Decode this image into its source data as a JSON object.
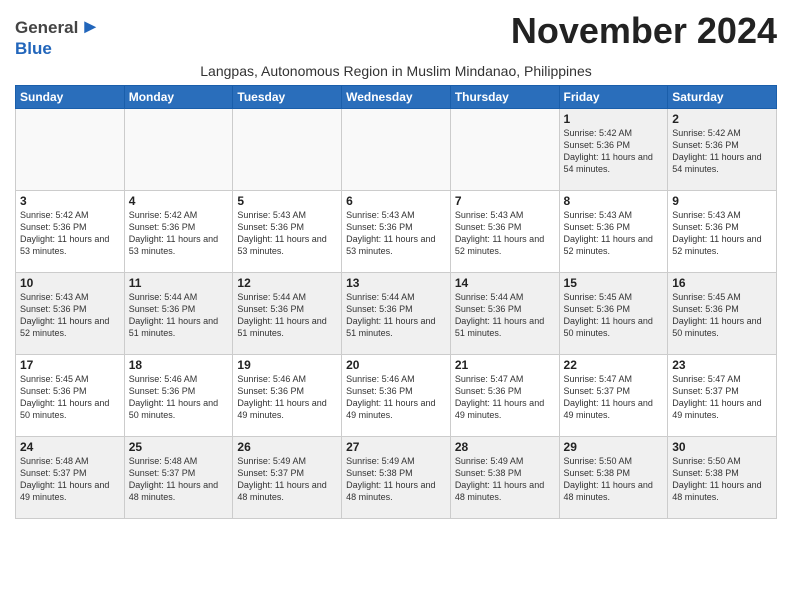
{
  "logo": {
    "general": "General",
    "blue": "Blue"
  },
  "month_title": "November 2024",
  "subtitle": "Langpas, Autonomous Region in Muslim Mindanao, Philippines",
  "weekdays": [
    "Sunday",
    "Monday",
    "Tuesday",
    "Wednesday",
    "Thursday",
    "Friday",
    "Saturday"
  ],
  "weeks": [
    [
      {
        "day": "",
        "info": ""
      },
      {
        "day": "",
        "info": ""
      },
      {
        "day": "",
        "info": ""
      },
      {
        "day": "",
        "info": ""
      },
      {
        "day": "",
        "info": ""
      },
      {
        "day": "1",
        "info": "Sunrise: 5:42 AM\nSunset: 5:36 PM\nDaylight: 11 hours\nand 54 minutes."
      },
      {
        "day": "2",
        "info": "Sunrise: 5:42 AM\nSunset: 5:36 PM\nDaylight: 11 hours\nand 54 minutes."
      }
    ],
    [
      {
        "day": "3",
        "info": "Sunrise: 5:42 AM\nSunset: 5:36 PM\nDaylight: 11 hours\nand 53 minutes."
      },
      {
        "day": "4",
        "info": "Sunrise: 5:42 AM\nSunset: 5:36 PM\nDaylight: 11 hours\nand 53 minutes."
      },
      {
        "day": "5",
        "info": "Sunrise: 5:43 AM\nSunset: 5:36 PM\nDaylight: 11 hours\nand 53 minutes."
      },
      {
        "day": "6",
        "info": "Sunrise: 5:43 AM\nSunset: 5:36 PM\nDaylight: 11 hours\nand 53 minutes."
      },
      {
        "day": "7",
        "info": "Sunrise: 5:43 AM\nSunset: 5:36 PM\nDaylight: 11 hours\nand 52 minutes."
      },
      {
        "day": "8",
        "info": "Sunrise: 5:43 AM\nSunset: 5:36 PM\nDaylight: 11 hours\nand 52 minutes."
      },
      {
        "day": "9",
        "info": "Sunrise: 5:43 AM\nSunset: 5:36 PM\nDaylight: 11 hours\nand 52 minutes."
      }
    ],
    [
      {
        "day": "10",
        "info": "Sunrise: 5:43 AM\nSunset: 5:36 PM\nDaylight: 11 hours\nand 52 minutes."
      },
      {
        "day": "11",
        "info": "Sunrise: 5:44 AM\nSunset: 5:36 PM\nDaylight: 11 hours\nand 51 minutes."
      },
      {
        "day": "12",
        "info": "Sunrise: 5:44 AM\nSunset: 5:36 PM\nDaylight: 11 hours\nand 51 minutes."
      },
      {
        "day": "13",
        "info": "Sunrise: 5:44 AM\nSunset: 5:36 PM\nDaylight: 11 hours\nand 51 minutes."
      },
      {
        "day": "14",
        "info": "Sunrise: 5:44 AM\nSunset: 5:36 PM\nDaylight: 11 hours\nand 51 minutes."
      },
      {
        "day": "15",
        "info": "Sunrise: 5:45 AM\nSunset: 5:36 PM\nDaylight: 11 hours\nand 50 minutes."
      },
      {
        "day": "16",
        "info": "Sunrise: 5:45 AM\nSunset: 5:36 PM\nDaylight: 11 hours\nand 50 minutes."
      }
    ],
    [
      {
        "day": "17",
        "info": "Sunrise: 5:45 AM\nSunset: 5:36 PM\nDaylight: 11 hours\nand 50 minutes."
      },
      {
        "day": "18",
        "info": "Sunrise: 5:46 AM\nSunset: 5:36 PM\nDaylight: 11 hours\nand 50 minutes."
      },
      {
        "day": "19",
        "info": "Sunrise: 5:46 AM\nSunset: 5:36 PM\nDaylight: 11 hours\nand 49 minutes."
      },
      {
        "day": "20",
        "info": "Sunrise: 5:46 AM\nSunset: 5:36 PM\nDaylight: 11 hours\nand 49 minutes."
      },
      {
        "day": "21",
        "info": "Sunrise: 5:47 AM\nSunset: 5:36 PM\nDaylight: 11 hours\nand 49 minutes."
      },
      {
        "day": "22",
        "info": "Sunrise: 5:47 AM\nSunset: 5:37 PM\nDaylight: 11 hours\nand 49 minutes."
      },
      {
        "day": "23",
        "info": "Sunrise: 5:47 AM\nSunset: 5:37 PM\nDaylight: 11 hours\nand 49 minutes."
      }
    ],
    [
      {
        "day": "24",
        "info": "Sunrise: 5:48 AM\nSunset: 5:37 PM\nDaylight: 11 hours\nand 49 minutes."
      },
      {
        "day": "25",
        "info": "Sunrise: 5:48 AM\nSunset: 5:37 PM\nDaylight: 11 hours\nand 48 minutes."
      },
      {
        "day": "26",
        "info": "Sunrise: 5:49 AM\nSunset: 5:37 PM\nDaylight: 11 hours\nand 48 minutes."
      },
      {
        "day": "27",
        "info": "Sunrise: 5:49 AM\nSunset: 5:38 PM\nDaylight: 11 hours\nand 48 minutes."
      },
      {
        "day": "28",
        "info": "Sunrise: 5:49 AM\nSunset: 5:38 PM\nDaylight: 11 hours\nand 48 minutes."
      },
      {
        "day": "29",
        "info": "Sunrise: 5:50 AM\nSunset: 5:38 PM\nDaylight: 11 hours\nand 48 minutes."
      },
      {
        "day": "30",
        "info": "Sunrise: 5:50 AM\nSunset: 5:38 PM\nDaylight: 11 hours\nand 48 minutes."
      }
    ]
  ]
}
